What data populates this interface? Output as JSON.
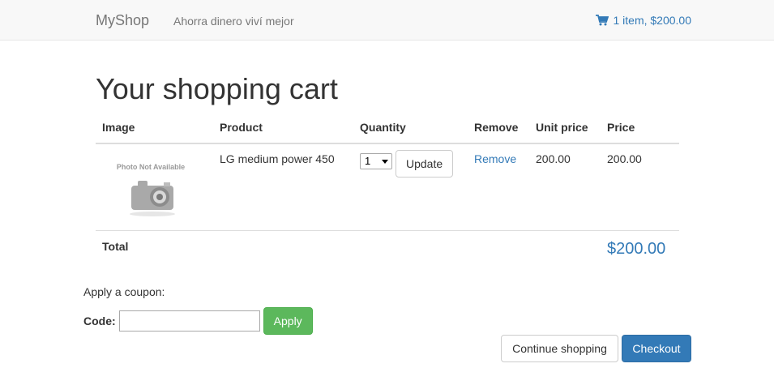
{
  "navbar": {
    "brand": "MyShop",
    "tagline": "Ahorra dinero viví mejor",
    "cart_summary": "1 item, $200.00",
    "cart_icon": "cart-icon"
  },
  "page": {
    "title": "Your shopping cart"
  },
  "table": {
    "headers": {
      "image": "Image",
      "product": "Product",
      "quantity": "Quantity",
      "remove": "Remove",
      "unit_price": "Unit price",
      "price": "Price"
    },
    "items": [
      {
        "image_text": "Photo Not Available",
        "product": "LG medium power 450",
        "quantity": "1",
        "update_label": "Update",
        "remove_label": "Remove",
        "unit_price": "200.00",
        "price": "200.00"
      }
    ],
    "total_label": "Total",
    "total_value": "$200.00"
  },
  "coupon": {
    "prompt": "Apply a coupon:",
    "code_label": "Code:",
    "code_value": "",
    "apply_label": "Apply"
  },
  "actions": {
    "continue_label": "Continue shopping",
    "checkout_label": "Checkout"
  },
  "colors": {
    "link": "#337ab7",
    "success": "#5cb85c",
    "primary": "#337ab7",
    "navbar_bg": "#f8f8f8"
  }
}
